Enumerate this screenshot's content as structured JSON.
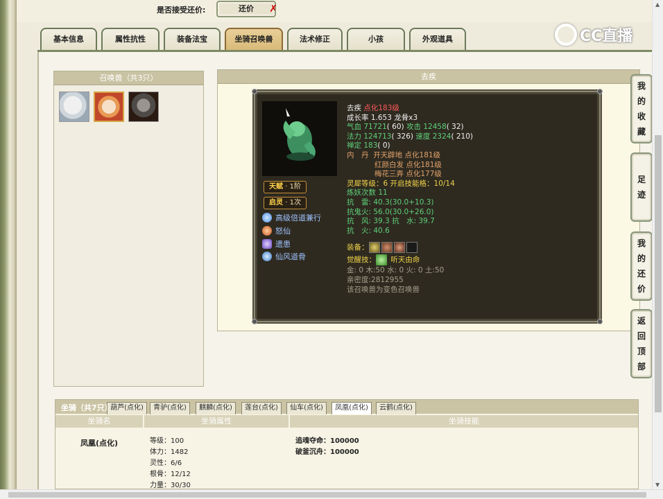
{
  "bargain": {
    "label": "是否接受还价:",
    "button": "还价"
  },
  "logo": {
    "text": "CC直播"
  },
  "tabs": [
    {
      "label": "基本信息"
    },
    {
      "label": "属性抗性"
    },
    {
      "label": "装备法宝"
    },
    {
      "label": "坐骑召唤兽",
      "active": true
    },
    {
      "label": "法术修正"
    },
    {
      "label": "小孩"
    },
    {
      "label": "外观道具"
    }
  ],
  "summon": {
    "header": "召唤兽（共3只）",
    "pets": [
      "polar-bear-pet",
      "fire-cat-pet",
      "wolf-pet"
    ]
  },
  "detail": {
    "header": "去疾",
    "talent": {
      "name": "天赋",
      "value": "1阶"
    },
    "awaken": {
      "name": "启灵",
      "value": "1次"
    },
    "skills": [
      "高级倍道兼行",
      "怒仙",
      "遗患",
      "仙风道骨"
    ],
    "name": "去疾",
    "refine": "点化183级",
    "growth": "成长率 1.653 龙骨x3",
    "hp_label": "气血",
    "hp": "71721",
    "hp_pt": "( 60)",
    "atk_label": "攻击",
    "atk": "12458",
    "atk_pt": "( 32)",
    "mp_label": "法力",
    "mp": "124713",
    "mp_pt": "( 326)",
    "spd_label": "速度",
    "spd": "2324",
    "spd_pt": "( 210)",
    "def_label": "禅定",
    "def": "183",
    "def_pt": "( 0)",
    "core_label": "内　丹",
    "cores": [
      "开天辟地 点化181级",
      "红颜白发 点化181级",
      "梅花三弄 点化177级"
    ],
    "lingxi": "灵犀等级：6 开启技能格：10/14",
    "lianyao": "炼妖次数 11",
    "res1": "抗　雷: 40.3(30.0+10.3)",
    "res2": "抗鬼火: 56.0(30.0+26.0)",
    "res3": "抗　风: 39.3 抗　水: 39.7",
    "res4": "抗　火: 40.6",
    "equip_label": "装备：",
    "awake_label": "觉醒技：",
    "awake_skill": "听天由命",
    "elements": "金: 0 木:50 水: 0 火: 0 土:50",
    "intimacy": "亲密度:2812955",
    "variant": "该召唤兽为变色召唤兽"
  },
  "sidenav": [
    {
      "label": "我的收藏",
      "chars": [
        "我",
        "的",
        "收",
        "藏"
      ]
    },
    {
      "label": "足迹",
      "chars": [
        "足",
        "迹"
      ]
    },
    {
      "label": "我的还价",
      "chars": [
        "我",
        "的",
        "还",
        "价"
      ]
    },
    {
      "label": "返回顶部",
      "chars": [
        "返",
        "回",
        "顶",
        "部"
      ]
    }
  ],
  "mount": {
    "title": "坐骑（共7只）",
    "tabs": [
      "葫芦(点化)",
      "青驴(点化)",
      "麒麟(点化)",
      "莲台(点化)",
      "仙车(点化)",
      "凤凰(点化)",
      "云鹤(点化)"
    ],
    "active_tab": "凤凰(点化)",
    "col_name": "坐骑名",
    "col_attr": "坐骑属性",
    "col_skill": "坐骑技能",
    "name": "凤凰(点化)",
    "attrs": [
      "等级：100",
      "体力：1482",
      "灵性：6/6",
      "根骨：12/12",
      "力量：30/30"
    ],
    "skills": [
      "追魂夺命：100000",
      "破釜沉舟：100000"
    ]
  }
}
